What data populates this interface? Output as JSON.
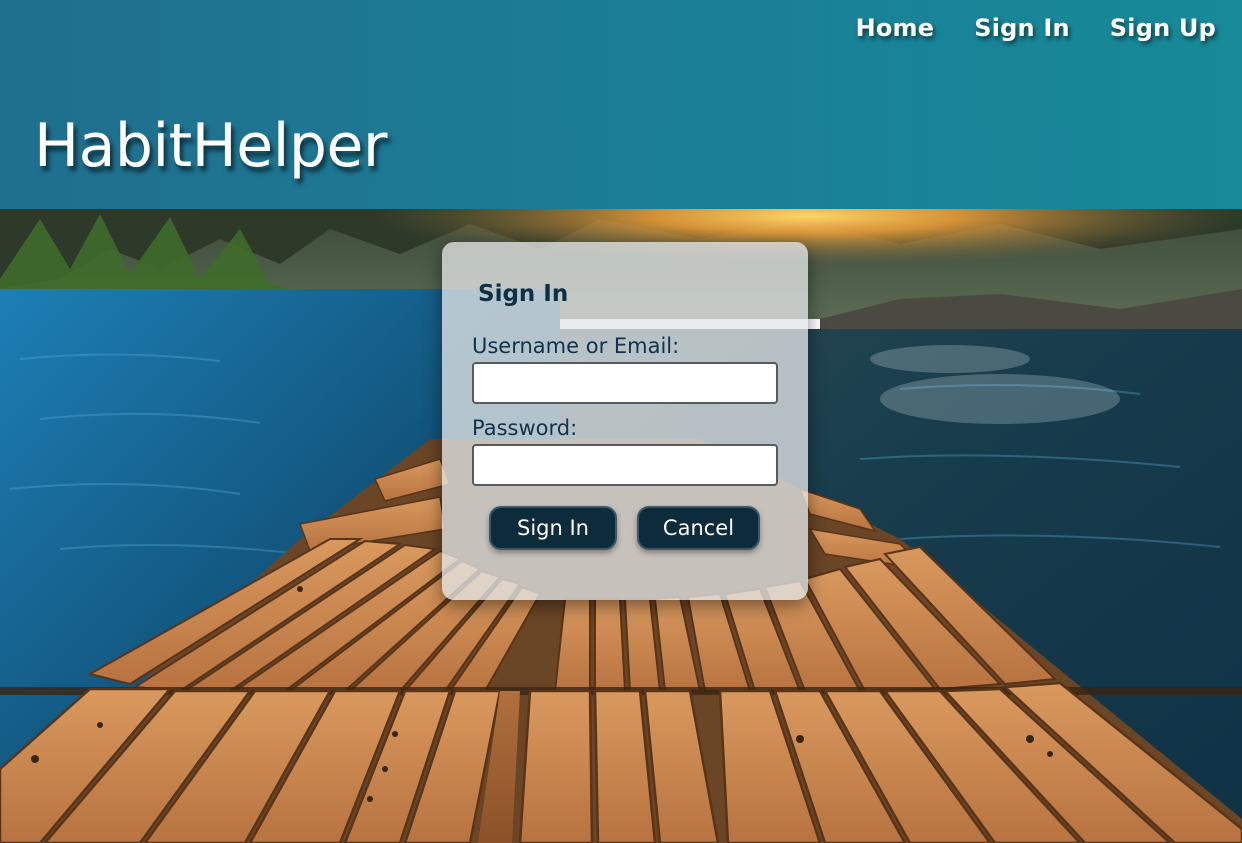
{
  "app": {
    "brand": "HabitHelper"
  },
  "nav": {
    "items": [
      {
        "label": "Home"
      },
      {
        "label": "Sign In"
      },
      {
        "label": "Sign Up"
      }
    ]
  },
  "signin": {
    "title": "Sign In",
    "username_label": "Username or Email:",
    "username_value": "",
    "password_label": "Password:",
    "password_value": "",
    "submit_label": "Sign In",
    "cancel_label": "Cancel"
  },
  "colors": {
    "header": "#1b7d96",
    "button": "#0c2b3b",
    "card": "#e1e4e6",
    "text_dark": "#0f2f44"
  },
  "background": {
    "description_icon": "lake-dock-sunset-image"
  }
}
